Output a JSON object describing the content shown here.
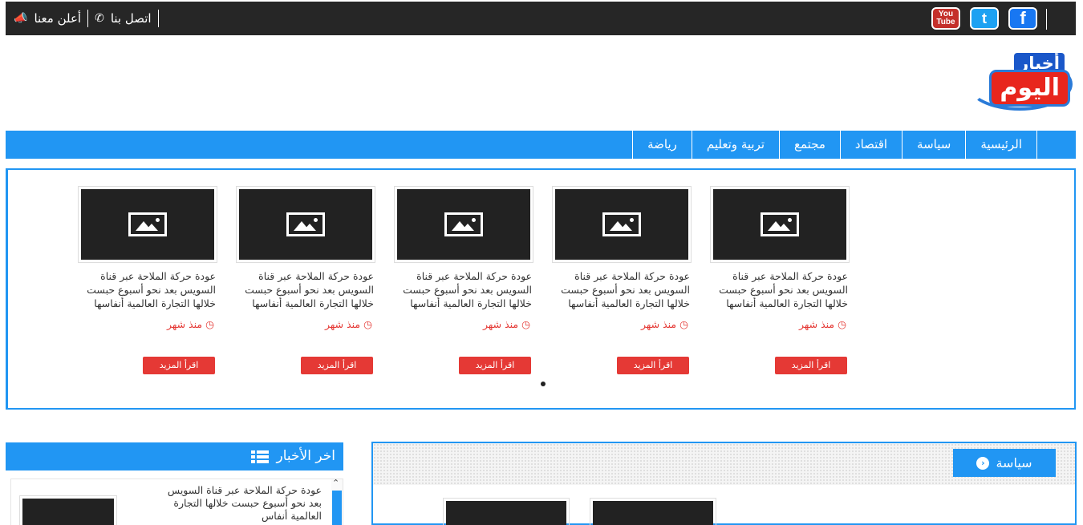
{
  "topbar": {
    "advertise": "أعلن معنا",
    "contact": "اتصل بنا",
    "social": {
      "youtube": "You Tube",
      "twitter": "t",
      "facebook": "f"
    }
  },
  "logo": {
    "top": "أخبار",
    "bottom": "اليوم"
  },
  "nav": [
    "الرئيسية",
    "سياسة",
    "اقتصاد",
    "مجتمع",
    "تربية وتعليم",
    "رياضة"
  ],
  "slider": {
    "cards": [
      {
        "text": "عودة حركة الملاحة عبر قناة السويس بعد نحو أسبوع حبست خلالها التجارة العالمية أنفاسها",
        "time": "منذ شهر",
        "more": "اقرأ المزيد"
      },
      {
        "text": "عودة حركة الملاحة عبر قناة السويس بعد نحو أسبوع حبست خلالها التجارة العالمية أنفاسها",
        "time": "منذ شهر",
        "more": "اقرأ المزيد"
      },
      {
        "text": "عودة حركة الملاحة عبر قناة السويس بعد نحو أسبوع حبست خلالها التجارة العالمية أنفاسها",
        "time": "منذ شهر",
        "more": "اقرأ المزيد"
      },
      {
        "text": "عودة حركة الملاحة عبر قناة السويس بعد نحو أسبوع حبست خلالها التجارة العالمية أنفاسها",
        "time": "منذ شهر",
        "more": "اقرأ المزيد"
      },
      {
        "text": "عودة حركة الملاحة عبر قناة السويس بعد نحو أسبوع حبست خلالها التجارة العالمية أنفاسها",
        "time": "منذ شهر",
        "more": "اقرأ المزيد"
      }
    ]
  },
  "latest": {
    "title": "اخر الأخبار",
    "item_text": "عودة حركة الملاحة عبر قناة السويس بعد نحو أسبوع حبست خلالها التجارة العالمية أنفاس"
  },
  "politics": {
    "title": "سياسة"
  },
  "colors": {
    "accent": "#2196f3",
    "topbar": "#262626",
    "red": "#e53935"
  }
}
